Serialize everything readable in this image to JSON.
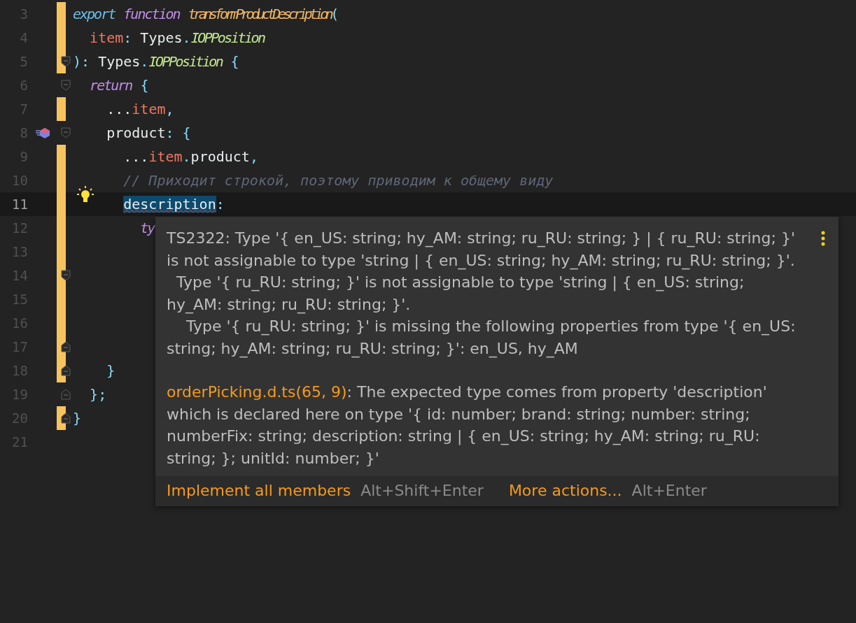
{
  "editor": {
    "lines": [
      {
        "number": "3",
        "changed": true,
        "current": false,
        "fold_start": false,
        "fold_end": false,
        "implementation_marker": false,
        "quick_fix": false,
        "tokens": [
          {
            "kind": "keyword",
            "text": "export"
          },
          {
            "kind": "storage",
            "text": " function"
          },
          {
            "kind": "function-name",
            "text": " transformProductDescription"
          },
          {
            "kind": "punct",
            "text": "("
          }
        ]
      },
      {
        "number": "4",
        "changed": true,
        "current": false,
        "fold_start": false,
        "fold_end": false,
        "implementation_marker": false,
        "quick_fix": false,
        "tokens": [
          {
            "kind": "variable",
            "text": "  item"
          },
          {
            "kind": "punct",
            "text": ": "
          },
          {
            "kind": "plain",
            "text": "Types"
          },
          {
            "kind": "punct",
            "text": "."
          },
          {
            "kind": "type",
            "text": "IOPPosition"
          }
        ]
      },
      {
        "number": "5",
        "changed": true,
        "current": false,
        "fold_start": true,
        "fold_end": false,
        "implementation_marker": false,
        "quick_fix": false,
        "tokens": [
          {
            "kind": "punct",
            "text": "): "
          },
          {
            "kind": "plain",
            "text": "Types"
          },
          {
            "kind": "punct",
            "text": "."
          },
          {
            "kind": "type",
            "text": "IOPPosition"
          },
          {
            "kind": "punct",
            "text": " {"
          }
        ]
      },
      {
        "number": "6",
        "changed": false,
        "current": false,
        "fold_start": true,
        "fold_end": false,
        "implementation_marker": false,
        "quick_fix": false,
        "tokens": [
          {
            "kind": "storage",
            "text": "  return"
          },
          {
            "kind": "punct",
            "text": " {"
          }
        ]
      },
      {
        "number": "7",
        "changed": true,
        "current": false,
        "fold_start": false,
        "fold_end": false,
        "implementation_marker": false,
        "quick_fix": false,
        "tokens": [
          {
            "kind": "plain",
            "text": "    ..."
          },
          {
            "kind": "variable",
            "text": "item"
          },
          {
            "kind": "punct",
            "text": ","
          }
        ]
      },
      {
        "number": "8",
        "changed": false,
        "current": false,
        "fold_start": true,
        "fold_end": false,
        "implementation_marker": true,
        "quick_fix": false,
        "tokens": [
          {
            "kind": "plain",
            "text": "    product"
          },
          {
            "kind": "punct",
            "text": ": {"
          }
        ]
      },
      {
        "number": "9",
        "changed": true,
        "current": false,
        "fold_start": false,
        "fold_end": false,
        "implementation_marker": false,
        "quick_fix": false,
        "tokens": [
          {
            "kind": "plain",
            "text": "      ..."
          },
          {
            "kind": "variable",
            "text": "item"
          },
          {
            "kind": "punct",
            "text": "."
          },
          {
            "kind": "plain",
            "text": "product"
          },
          {
            "kind": "punct",
            "text": ","
          }
        ]
      },
      {
        "number": "10",
        "changed": true,
        "current": false,
        "fold_start": false,
        "fold_end": false,
        "implementation_marker": false,
        "quick_fix": false,
        "tokens": [
          {
            "kind": "comment",
            "text": "      // Приходит строкой, поэтому приводим к общему виду"
          }
        ]
      },
      {
        "number": "11",
        "changed": true,
        "current": true,
        "fold_start": false,
        "fold_end": false,
        "implementation_marker": false,
        "quick_fix": true,
        "tokens": [
          {
            "kind": "error",
            "text": "      description"
          },
          {
            "kind": "punct",
            "text": ":"
          }
        ]
      },
      {
        "number": "12",
        "changed": true,
        "current": false,
        "fold_start": false,
        "fold_end": false,
        "implementation_marker": false,
        "quick_fix": false,
        "tokens": [
          {
            "kind": "storage",
            "text": "        ty"
          }
        ]
      },
      {
        "number": "13",
        "changed": true,
        "current": false,
        "fold_start": false,
        "fold_end": false,
        "implementation_marker": false,
        "quick_fix": false
      },
      {
        "number": "14",
        "changed": true,
        "current": false,
        "fold_start": true,
        "fold_end": false,
        "implementation_marker": false,
        "quick_fix": false
      },
      {
        "number": "15",
        "changed": true,
        "current": false,
        "fold_start": false,
        "fold_end": false,
        "implementation_marker": false,
        "quick_fix": false
      },
      {
        "number": "16",
        "changed": true,
        "current": false,
        "fold_start": false,
        "fold_end": false,
        "implementation_marker": false,
        "quick_fix": false
      },
      {
        "number": "17",
        "changed": true,
        "current": false,
        "fold_start": false,
        "fold_end": true,
        "implementation_marker": false,
        "quick_fix": false
      },
      {
        "number": "18",
        "changed": true,
        "current": false,
        "fold_start": false,
        "fold_end": true,
        "implementation_marker": false,
        "quick_fix": false,
        "tokens": [
          {
            "kind": "punct",
            "text": "    }"
          }
        ]
      },
      {
        "number": "19",
        "changed": false,
        "current": false,
        "fold_start": false,
        "fold_end": true,
        "implementation_marker": false,
        "quick_fix": false,
        "tokens": [
          {
            "kind": "punct",
            "text": "  };"
          }
        ]
      },
      {
        "number": "20",
        "changed": true,
        "current": false,
        "fold_start": false,
        "fold_end": true,
        "implementation_marker": false,
        "quick_fix": false,
        "tokens": [
          {
            "kind": "punct",
            "text": "}"
          }
        ]
      },
      {
        "number": "21",
        "changed": false,
        "current": false,
        "fold_start": false,
        "fold_end": false,
        "implementation_marker": false,
        "quick_fix": false
      }
    ]
  },
  "popup": {
    "paragraphs": [
      {
        "text": "TS2322: Type '{ en_US: string; hy_AM: string; ru_RU: string; } | { ru_RU: string; }' is not assignable to type 'string | { en_US: string; hy_AM: string; ru_RU: string; }'."
      },
      {
        "text": "  Type '{ ru_RU: string; }' is not assignable to type 'string | { en_US: string; hy_AM: string; ru_RU: string; }'."
      },
      {
        "text": "    Type '{ ru_RU: string; }' is missing the following properties from type '{ en_US: string; hy_AM: string; ru_RU: string; }': en_US, hy_AM"
      },
      {
        "link": "orderPicking.d.ts(65, 9)",
        "text": ": The expected type comes from property 'description' which is declared here on type '{ id: number; brand: string; number: string; numberFix: string; description: string | { en_US: string; hy_AM: string; ru_RU: string; }; unitId: number; }'"
      }
    ],
    "actions": [
      {
        "label": "Implement all members",
        "shortcut": "Alt+Shift+Enter"
      },
      {
        "label": "More actions...",
        "shortcut": "Alt+Enter"
      }
    ]
  }
}
